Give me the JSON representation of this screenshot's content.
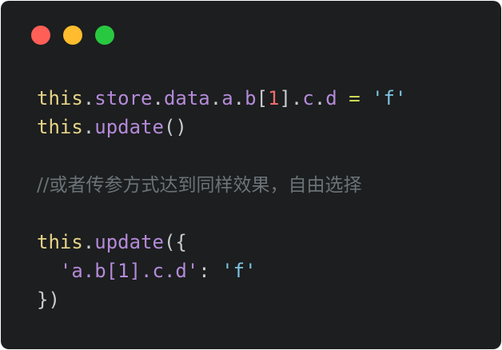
{
  "window": {
    "buttons": [
      {
        "name": "close-button",
        "color": "#ff5f57"
      },
      {
        "name": "minimize-button",
        "color": "#febc2e"
      },
      {
        "name": "zoom-button",
        "color": "#28c840"
      }
    ]
  },
  "colors": {
    "keyword": "#e6d487",
    "property": "#b48ad9",
    "string": "#7fc4e3",
    "number": "#ef6b6b",
    "operator": "#cdd956",
    "punctuation": "#c8cbd0",
    "comment": "#6b7378"
  },
  "code": {
    "lines": [
      [
        [
          "keyword",
          "this"
        ],
        [
          "punctuation",
          "."
        ],
        [
          "property",
          "store"
        ],
        [
          "punctuation",
          "."
        ],
        [
          "property",
          "data"
        ],
        [
          "punctuation",
          "."
        ],
        [
          "property",
          "a"
        ],
        [
          "punctuation",
          "."
        ],
        [
          "property",
          "b"
        ],
        [
          "punctuation",
          "["
        ],
        [
          "number",
          "1"
        ],
        [
          "punctuation",
          "]."
        ],
        [
          "property",
          "c"
        ],
        [
          "punctuation",
          "."
        ],
        [
          "property",
          "d"
        ],
        [
          "punctuation",
          " "
        ],
        [
          "operator",
          "="
        ],
        [
          "punctuation",
          " "
        ],
        [
          "string",
          "'f'"
        ]
      ],
      [
        [
          "keyword",
          "this"
        ],
        [
          "punctuation",
          "."
        ],
        [
          "property",
          "update"
        ],
        [
          "punctuation",
          "()"
        ]
      ],
      [],
      [
        [
          "comment",
          "//或者传参方式达到同样效果，自由选择"
        ]
      ],
      [],
      [
        [
          "keyword",
          "this"
        ],
        [
          "punctuation",
          "."
        ],
        [
          "property",
          "update"
        ],
        [
          "punctuation",
          "({"
        ]
      ],
      [
        [
          "punctuation",
          "  "
        ],
        [
          "property",
          "'a.b[1].c.d'"
        ],
        [
          "punctuation",
          ": "
        ],
        [
          "string",
          "'f'"
        ]
      ],
      [
        [
          "punctuation",
          "})"
        ]
      ]
    ]
  }
}
